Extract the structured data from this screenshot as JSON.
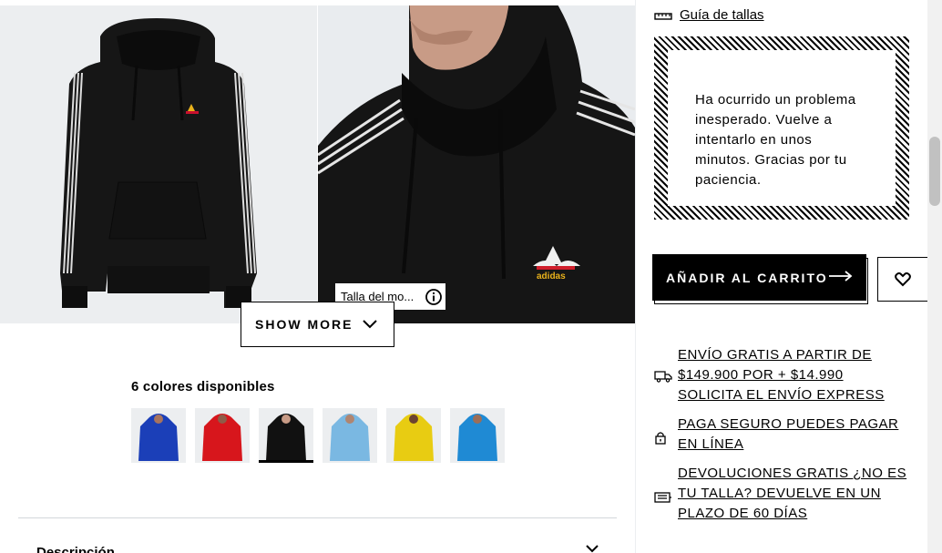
{
  "gallery": {
    "size_tag_label": "Talla del mo...",
    "show_more_label": "SHOW MORE"
  },
  "colors": {
    "title": "6 colores disponibles",
    "swatches": [
      {
        "color": "#1b3fb8",
        "name": "blue-hoodie"
      },
      {
        "color": "#d7161c",
        "name": "red-hoodie"
      },
      {
        "color": "#111111",
        "name": "black-hoodie",
        "selected": true
      },
      {
        "color": "#7ab8e2",
        "name": "light-blue-hoodie"
      },
      {
        "color": "#e8cc12",
        "name": "yellow-hoodie"
      },
      {
        "color": "#1f8ad4",
        "name": "sky-blue-hoodie"
      }
    ]
  },
  "description": {
    "label": "Descripción"
  },
  "panel": {
    "size_guide_label": "Guía de tallas",
    "error_message": "Ha ocurrido un problema inesperado. Vuelve a intentarlo en unos minutos. Gracias por tu paciencia.",
    "add_to_cart_label": "AÑADIR AL CARRITO",
    "usps": [
      {
        "icon": "truck-icon",
        "text": "ENVÍO GRATIS A PARTIR DE $149.900 POR + $14.990 SOLICITA EL ENVÍO EXPRESS"
      },
      {
        "icon": "lock-icon",
        "text": "PAGA SEGURO PUEDES PAGAR EN LÍNEA"
      },
      {
        "icon": "return-icon",
        "text": "DEVOLUCIONES GRATIS ¿NO ES TU TALLA? DEVUELVE EN UN PLAZO DE 60 DÍAS"
      }
    ]
  },
  "theme": {
    "accent": "#000000",
    "background": "#ffffff",
    "image_bg": "#eceef0"
  }
}
